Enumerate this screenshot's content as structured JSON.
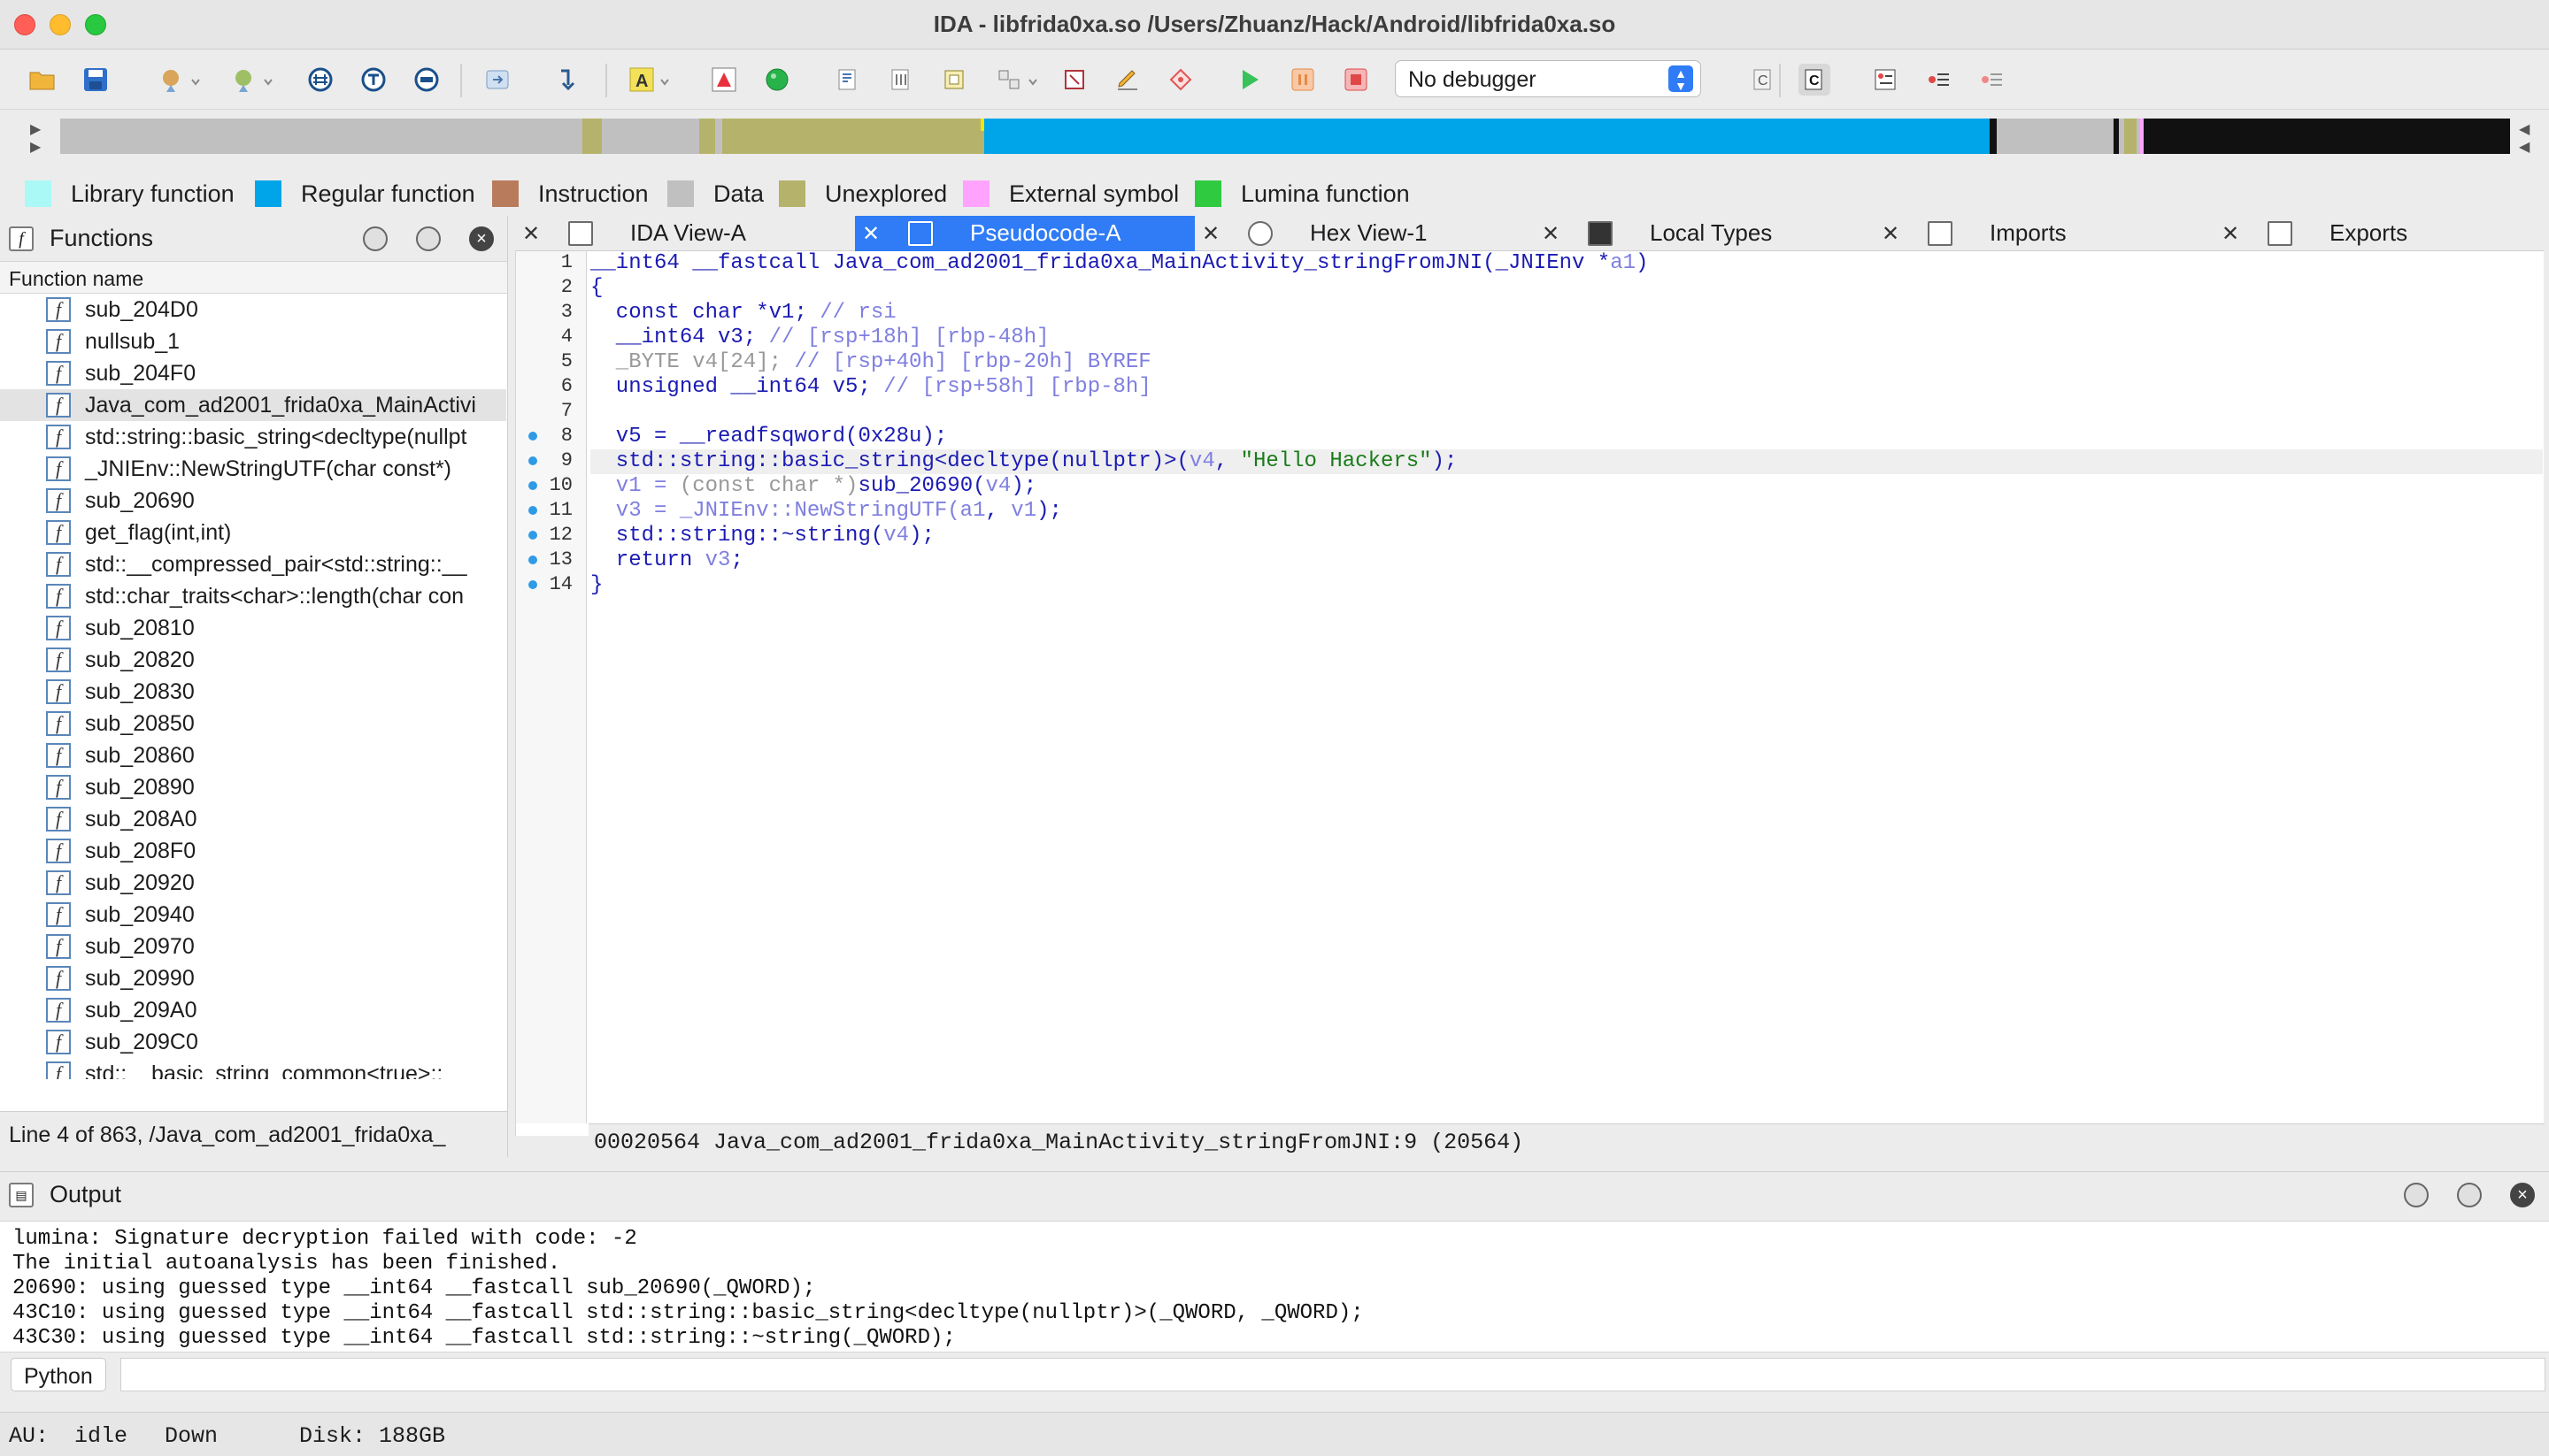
{
  "window": {
    "title": "IDA - libfrida0xa.so /Users/Zhuanz/Hack/Android/libfrida0xa.so"
  },
  "toolbar": {
    "debugger": "No debugger"
  },
  "legend": [
    {
      "label": "Library function",
      "color": "#aaf9f6"
    },
    {
      "label": "Regular function",
      "color": "#00a4e8"
    },
    {
      "label": "Instruction",
      "color": "#b87c5c"
    },
    {
      "label": "Data",
      "color": "#c0c0c0"
    },
    {
      "label": "Unexplored",
      "color": "#b5b36b"
    },
    {
      "label": "External symbol",
      "color": "#ffa3ff"
    },
    {
      "label": "Lumina function",
      "color": "#2fca3f"
    }
  ],
  "functions": {
    "title": "Functions",
    "column": "Function name",
    "items": [
      "sub_204D0",
      "nullsub_1",
      "sub_204F0",
      "Java_com_ad2001_frida0xa_MainActivi",
      "std::string::basic_string<decltype(nullpt",
      "_JNIEnv::NewStringUTF(char const*)",
      "sub_20690",
      "get_flag(int,int)",
      "std::__compressed_pair<std::string::__",
      "std::char_traits<char>::length(char con",
      "sub_20810",
      "sub_20820",
      "sub_20830",
      "sub_20850",
      "sub_20860",
      "sub_20890",
      "sub_208A0",
      "sub_208F0",
      "sub_20920",
      "sub_20940",
      "sub_20970",
      "sub_20990",
      "sub_209A0",
      "sub_209C0",
      "std::__basic_string_common<true>::__"
    ],
    "status": "Line 4 of 863, /Java_com_ad2001_frida0xa_"
  },
  "tabs": [
    {
      "label": "IDA View-A"
    },
    {
      "label": "Pseudocode-A"
    },
    {
      "label": "Hex View-1"
    },
    {
      "label": "Local Types"
    },
    {
      "label": "Imports"
    },
    {
      "label": "Exports"
    }
  ],
  "pseudocode": {
    "lines": [
      {
        "n": "1",
        "bp": false
      },
      {
        "n": "2",
        "bp": false
      },
      {
        "n": "3",
        "bp": false
      },
      {
        "n": "4",
        "bp": false
      },
      {
        "n": "5",
        "bp": false
      },
      {
        "n": "6",
        "bp": false
      },
      {
        "n": "7",
        "bp": false
      },
      {
        "n": "8",
        "bp": true
      },
      {
        "n": "9",
        "bp": true
      },
      {
        "n": "10",
        "bp": true
      },
      {
        "n": "11",
        "bp": true
      },
      {
        "n": "12",
        "bp": true
      },
      {
        "n": "13",
        "bp": true
      },
      {
        "n": "14",
        "bp": true
      }
    ],
    "code": {
      "l1a": "__int64 __fastcall ",
      "l1b": "Java_com_ad2001_frida0xa_MainActivity_stringFromJNI(_JNIEnv *",
      "l1c": "a1",
      "l1d": ")",
      "l2": "{",
      "l3a": "  const char *v1; ",
      "l3b": "// rsi",
      "l4a": "  __int64 v3; ",
      "l4b": "// [rsp+18h] [rbp-48h]",
      "l5a": "  _BYTE v4[24]; ",
      "l5b": "// [rsp+40h] [rbp-20h] BYREF",
      "l6a": "  unsigned __int64 v5; ",
      "l6b": "// [rsp+58h] [rbp-8h]",
      "l8a": "  v5 = __readfsqword(0x28u);",
      "l9a": "  std::string::basic_string<decltype(nullptr)>(",
      "l9b": "v4",
      "l9c": ", ",
      "l9d": "\"Hello Hackers\"",
      "l9e": ");",
      "l10a": "  v1 = ",
      "l10b": "(const char *)",
      "l10c": "sub_20690(",
      "l10d": "v4",
      "l10e": ");",
      "l11a": "  v3 = _JNIEnv::NewStringUTF(",
      "l11b": "a1",
      "l11c": ", ",
      "l11d": "v1",
      "l11e": ");",
      "l12a": "  std::string::~string(",
      "l12b": "v4",
      "l12c": ");",
      "l13a": "  return ",
      "l13b": "v3",
      "l13c": ";",
      "l14": "}"
    },
    "status": "00020564 Java_com_ad2001_frida0xa_MainActivity_stringFromJNI:9 (20564)"
  },
  "output": {
    "title": "Output",
    "lines": [
      "lumina: Signature decryption failed with code: -2",
      "The initial autoanalysis has been finished.",
      "20690: using guessed type __int64 __fastcall sub_20690(_QWORD);",
      "43C10: using guessed type __int64 __fastcall std::string::basic_string<decltype(nullptr)>(_QWORD, _QWORD);",
      "43C30: using guessed type __int64 __fastcall std::string::~string(_QWORD);"
    ]
  },
  "python": {
    "label": "Python"
  },
  "status": {
    "au": "AU:",
    "state": "idle",
    "dir": "Down",
    "disk": "Disk: 188GB"
  }
}
